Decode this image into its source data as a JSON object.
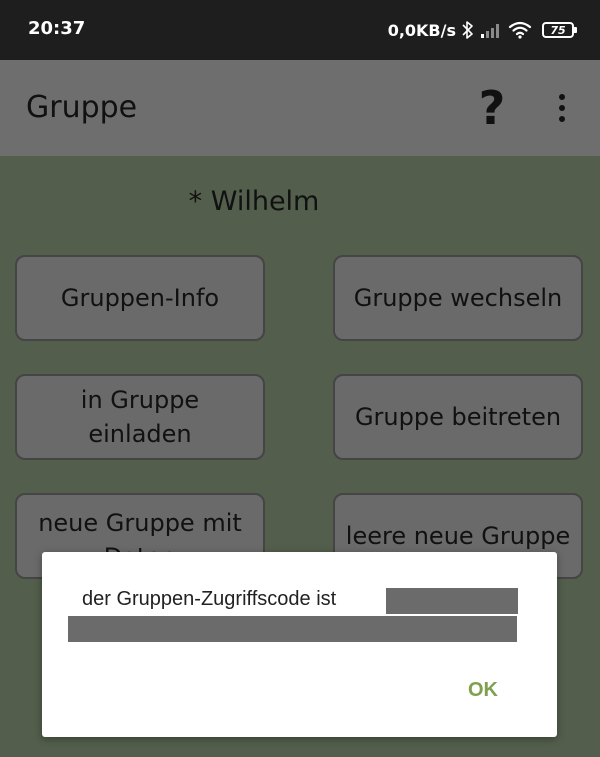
{
  "status_bar": {
    "time": "20:37",
    "net_speed": "0,0KB/s",
    "battery_level": "75"
  },
  "app_bar": {
    "title": "Gruppe",
    "help_label": "?"
  },
  "group": {
    "current_user": "* Wilhelm"
  },
  "buttons": {
    "group_info": "Gruppen-Info",
    "switch_group": "Gruppe wechseln",
    "invite_line1": "in Gruppe",
    "invite_line2": "einladen",
    "join_group": "Gruppe beitreten",
    "new_with_data_line1": "neue Gruppe mit",
    "new_with_data_line2": "Daten",
    "empty_new_group": "leere neue Gruppe"
  },
  "dialog": {
    "message": "der Gruppen-Zugriffscode ist",
    "ok_label": "OK"
  },
  "colors": {
    "background": "#535e4c",
    "app_bar": "#6e6e6e",
    "status_bar": "#1e1e1e",
    "button": "#6a6a6a",
    "dialog_accent": "#7fa04f"
  }
}
